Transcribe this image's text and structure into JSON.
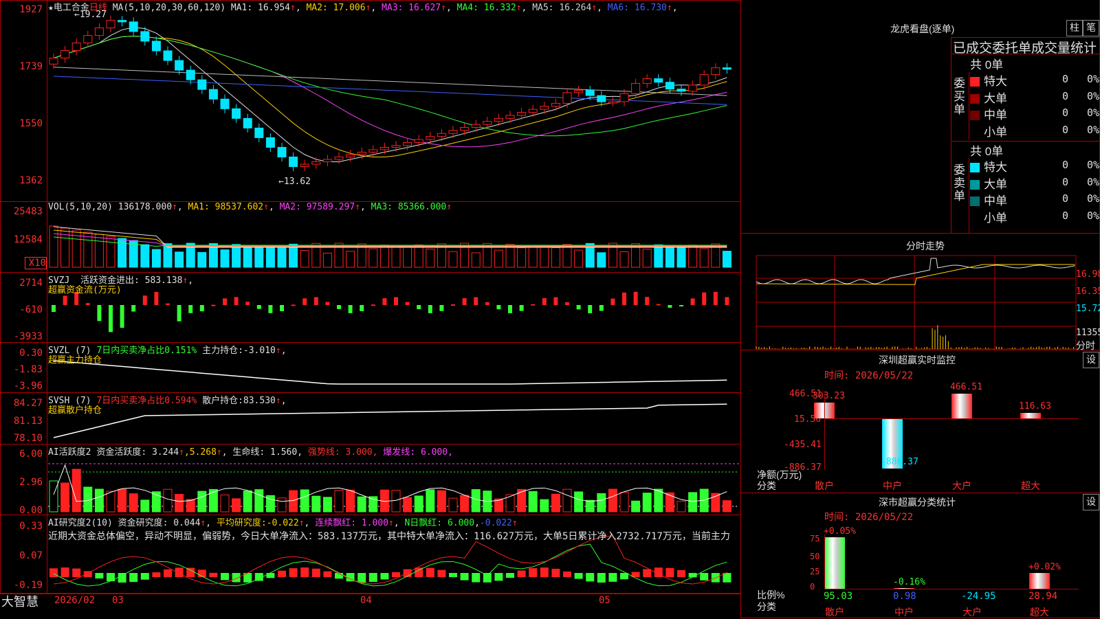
{
  "stock": {
    "name": "电工合金",
    "period": "日线"
  },
  "kline": {
    "ma_label": "MA(5,10,20,30,60,120)",
    "ma": [
      {
        "name": "MA1",
        "value": "16.954",
        "color": "#e0e0e0"
      },
      {
        "name": "MA2",
        "value": "17.006",
        "color": "#ffd000"
      },
      {
        "name": "MA3",
        "value": "16.627",
        "color": "#ff40ff"
      },
      {
        "name": "MA4",
        "value": "16.332",
        "color": "#30ff30"
      },
      {
        "name": "MA5",
        "value": "16.264",
        "color": "#d0d0d0"
      },
      {
        "name": "MA6",
        "value": "16.730",
        "color": "#4060ff"
      }
    ],
    "y_ticks": [
      "1927",
      "1739",
      "1550",
      "1362"
    ],
    "high_label": "19.27",
    "low_label": "13.62",
    "high_arrow": "←",
    "low_arrow": "←"
  },
  "vol": {
    "header": "VOL(5,10,20)",
    "value": "136178.000",
    "ma": [
      {
        "name": "MA1",
        "value": "98537.602"
      },
      {
        "name": "MA2",
        "value": "97589.297"
      },
      {
        "name": "MA3",
        "value": "85366.000"
      }
    ],
    "y_ticks": [
      "25483",
      "12584"
    ],
    "unit": "X10"
  },
  "svzj": {
    "header": "SVZJ",
    "label": "活跃资金进出:",
    "value": "583.138",
    "sub": "超赢资金流(万元)",
    "y_ticks": [
      "2714",
      "-610",
      "-3933"
    ]
  },
  "svzl": {
    "header": "SVZL (7)",
    "text1": "7日内买卖净占比0.151%",
    "label": "主力持仓:",
    "value": "-3.010",
    "sub": "超赢主力持仓",
    "y_ticks": [
      "0.30",
      "-1.83",
      "-3.96"
    ]
  },
  "svsh": {
    "header": "SVSH (7)",
    "text1": "7日内买卖净占比0.594%",
    "label": "散户持仓:",
    "value": "83.530",
    "sub": "超赢散户持仓",
    "y_ticks": [
      "84.27",
      "81.13",
      "78.10"
    ]
  },
  "ai1": {
    "header": "AI活跃度2",
    "l1": "资金活跃度:",
    "v1": "3.244",
    "v2": "5.268",
    "l3": "生命线:",
    "v3": "1.560",
    "l4": "强势线:",
    "v4": "3.000",
    "l5": "爆发线:",
    "v5": "6.000",
    "y_ticks": [
      "6.00",
      "2.96",
      "0.00"
    ]
  },
  "ai2": {
    "header": "AI研究度2(10)",
    "l1": "资金研究度:",
    "v1": "0.044",
    "l2": "平均研究度:",
    "v2": "-0.022",
    "l3": "连续飘红:",
    "v3": "1.000",
    "l4": "N日飘红:",
    "v4": "6.000",
    "v5": "-0.022",
    "comment": "近期大资金总体偏空，异动不明显，偏弱势，今日大单净流入：583.137万元，其中特大单净流入：116.627万元，大单5日累计净入2732.717万元，当前主力",
    "y_ticks": [
      "0.33",
      "0.07",
      "-0.19"
    ]
  },
  "arrow": "↑",
  "star": "★",
  "xaxis": {
    "labels": [
      "2026/02",
      "03",
      "04",
      "05"
    ]
  },
  "brand": "大智慧",
  "lhb": {
    "title": "龙虎看盘(逐单)",
    "btn1": "柱",
    "btn2": "笔",
    "tabs": "已成交委托单成交量统计",
    "buy_total": "共 0单",
    "sell_total": "共 0单",
    "buy_label": "委买单",
    "sell_label": "委卖单",
    "buy_rows": [
      {
        "name": "特大",
        "count": "0",
        "pct": "0%",
        "color": "#ff2020"
      },
      {
        "name": "大单",
        "count": "0",
        "pct": "0%",
        "color": "#a00000"
      },
      {
        "name": "中单",
        "count": "0",
        "pct": "0%",
        "color": "#700000"
      },
      {
        "name": "小单",
        "count": "0",
        "pct": "0%",
        "color": "#000000"
      }
    ],
    "sell_rows": [
      {
        "name": "特大",
        "count": "0",
        "pct": "0%",
        "color": "#00e5ff"
      },
      {
        "name": "大单",
        "count": "0",
        "pct": "0%",
        "color": "#009a9a"
      },
      {
        "name": "中单",
        "count": "0",
        "pct": "0%",
        "color": "#007070"
      },
      {
        "name": "小单",
        "count": "0",
        "pct": "0%",
        "color": "#000000"
      }
    ]
  },
  "intraday": {
    "title": "分时走势",
    "y_ticks": [
      "16.98",
      "16.35",
      "15.72",
      "11355"
    ],
    "unit": "分时"
  },
  "sz_monitor": {
    "title": "深圳超赢实时监控",
    "btn": "设",
    "time": "时间: 2026/05/22",
    "y_ticks": [
      "466.51",
      "15.56",
      "-435.41",
      "-886.37"
    ],
    "ylabel1": "净额(万元)",
    "ylabel2": "分类",
    "cats": [
      "散户",
      "中户",
      "大户",
      "超大"
    ],
    "values": [
      303.23,
      -886.37,
      466.51,
      116.63
    ],
    "value_labels": [
      "303.23",
      "-886.37",
      "466.51",
      "116.63"
    ]
  },
  "sz_class": {
    "title": "深市超赢分类统计",
    "btn": "设",
    "time": "时间: 2026/05/22",
    "y_ticks": [
      "75",
      "50",
      "25",
      "0"
    ],
    "ylabel1": "比例%",
    "ylabel2": "分类",
    "cats": [
      "散户",
      "中户",
      "大户",
      "超大"
    ],
    "pct_labels": [
      "+0.05%",
      "-0.16%",
      "",
      "+0.02%"
    ],
    "bottom_vals": [
      "95.03",
      "0.98",
      "-24.95",
      "28.94"
    ],
    "values": [
      95.03,
      0.98,
      0,
      28.94
    ]
  }
}
